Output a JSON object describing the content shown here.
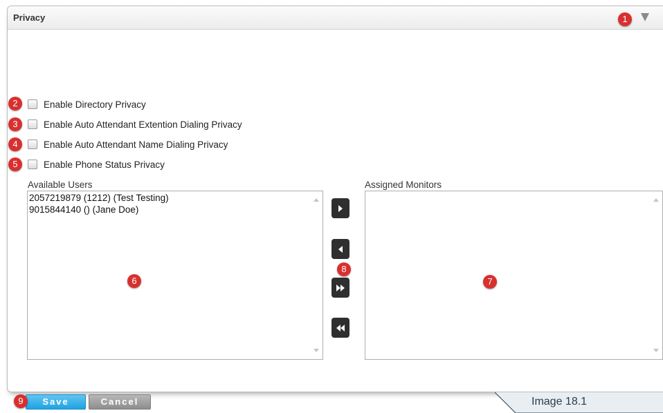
{
  "panel": {
    "title": "Privacy"
  },
  "checkboxes": [
    {
      "label": "Enable Directory Privacy",
      "checked": false
    },
    {
      "label": "Enable Auto Attendant Extention Dialing Privacy",
      "checked": false
    },
    {
      "label": "Enable Auto Attendant Name Dialing Privacy",
      "checked": false
    },
    {
      "label": "Enable Phone Status Privacy",
      "checked": false
    }
  ],
  "available_users": {
    "label": "Available Users",
    "items": [
      "2057219879 (1212) (Test Testing)",
      "9015844140 () (Jane Doe)"
    ]
  },
  "assigned_monitors": {
    "label": "Assigned Monitors",
    "items": []
  },
  "move_buttons": {
    "move_right": "play-right-icon",
    "move_left": "play-left-icon",
    "move_all_right": "fast-forward-icon",
    "move_all_left": "rewind-icon"
  },
  "actions": {
    "save_label": "Save",
    "cancel_label": "Cancel"
  },
  "callouts": [
    "1",
    "2",
    "3",
    "4",
    "5",
    "6",
    "7",
    "8",
    "9"
  ],
  "caption": "Image 18.1",
  "colors": {
    "callout": "#d8302f",
    "save": "#1fa2e3",
    "cancel": "#8d8d8d",
    "move_button": "#2f2f2f"
  }
}
